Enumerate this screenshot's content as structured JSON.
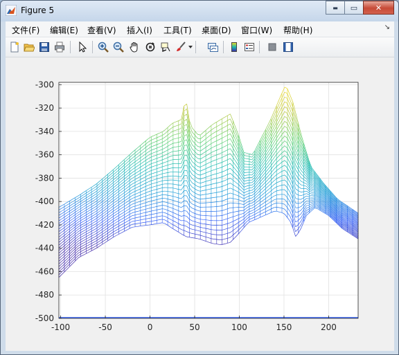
{
  "window": {
    "title": "Figure 5",
    "controls": {
      "minimize": "▬",
      "maximize": "▭",
      "close": "✕"
    }
  },
  "menu": {
    "items": [
      {
        "id": "file",
        "label": "文件(F)"
      },
      {
        "id": "edit",
        "label": "编辑(E)"
      },
      {
        "id": "view",
        "label": "查看(V)"
      },
      {
        "id": "insert",
        "label": "插入(I)"
      },
      {
        "id": "tools",
        "label": "工具(T)"
      },
      {
        "id": "desktop",
        "label": "桌面(D)"
      },
      {
        "id": "window",
        "label": "窗口(W)"
      },
      {
        "id": "help",
        "label": "帮助(H)"
      }
    ],
    "dock_arrow": "↘"
  },
  "toolbar": {
    "buttons": [
      {
        "name": "new-figure-button",
        "icon": "new-file-icon"
      },
      {
        "name": "open-button",
        "icon": "folder-icon"
      },
      {
        "name": "save-button",
        "icon": "save-icon"
      },
      {
        "name": "print-button",
        "icon": "print-icon"
      },
      {
        "name": "edit-plot-button",
        "icon": "pointer-icon"
      },
      {
        "name": "zoom-in-button",
        "icon": "zoom-in-icon"
      },
      {
        "name": "zoom-out-button",
        "icon": "zoom-out-icon"
      },
      {
        "name": "pan-button",
        "icon": "hand-icon"
      },
      {
        "name": "rotate-3d-button",
        "icon": "rotate-icon"
      },
      {
        "name": "data-cursor-button",
        "icon": "data-cursor-icon"
      },
      {
        "name": "brush-button",
        "icon": "brush-icon"
      },
      {
        "name": "link-plot-button",
        "icon": "link-icon"
      },
      {
        "name": "insert-colorbar-button",
        "icon": "colorbar-icon"
      },
      {
        "name": "insert-legend-button",
        "icon": "legend-icon"
      },
      {
        "name": "hide-plot-tools-button",
        "icon": "hide-tools-icon"
      },
      {
        "name": "show-plot-tools-button",
        "icon": "show-tools-icon"
      }
    ]
  },
  "chart_data": {
    "type": "mesh",
    "title": "",
    "xlabel": "",
    "ylabel": "",
    "xlim": [
      -102,
      233
    ],
    "ylim": [
      -500,
      -298
    ],
    "xticks": [
      -100,
      -50,
      0,
      50,
      100,
      150,
      200
    ],
    "yticks": [
      -500,
      -480,
      -460,
      -440,
      -420,
      -400,
      -380,
      -360,
      -340,
      -320,
      -300
    ],
    "grid": true,
    "colormap": [
      "#3e26a8",
      "#2f5cf4",
      "#1b9ad8",
      "#19b9b0",
      "#5fcf6a",
      "#bcc73a",
      "#f5dc1e"
    ],
    "top_edge": {
      "x": [
        -102,
        -80,
        -60,
        -40,
        -20,
        0,
        15,
        25,
        35,
        40,
        45,
        55,
        70,
        90,
        100,
        105,
        115,
        125,
        135,
        145,
        152,
        160,
        170,
        180,
        195,
        210,
        233
      ],
      "y": [
        -405,
        -395,
        -385,
        -372,
        -358,
        -345,
        -340,
        -333,
        -330,
        -311,
        -335,
        -344,
        -334,
        -325,
        -345,
        -358,
        -360,
        -345,
        -330,
        -312,
        -300,
        -315,
        -345,
        -370,
        -385,
        -398,
        -410
      ]
    },
    "bottom_edge": {
      "x": [
        -102,
        -80,
        -60,
        -40,
        -20,
        0,
        15,
        25,
        40,
        55,
        70,
        80,
        90,
        100,
        110,
        125,
        140,
        150,
        158,
        163,
        168,
        175,
        185,
        200,
        215,
        233
      ],
      "y": [
        -465,
        -448,
        -440,
        -430,
        -422,
        -420,
        -418,
        -423,
        -430,
        -432,
        -436,
        -437,
        -435,
        -427,
        -418,
        -413,
        -408,
        -410,
        -418,
        -430,
        -425,
        -412,
        -405,
        -412,
        -423,
        -432
      ]
    },
    "baseline": -500
  }
}
